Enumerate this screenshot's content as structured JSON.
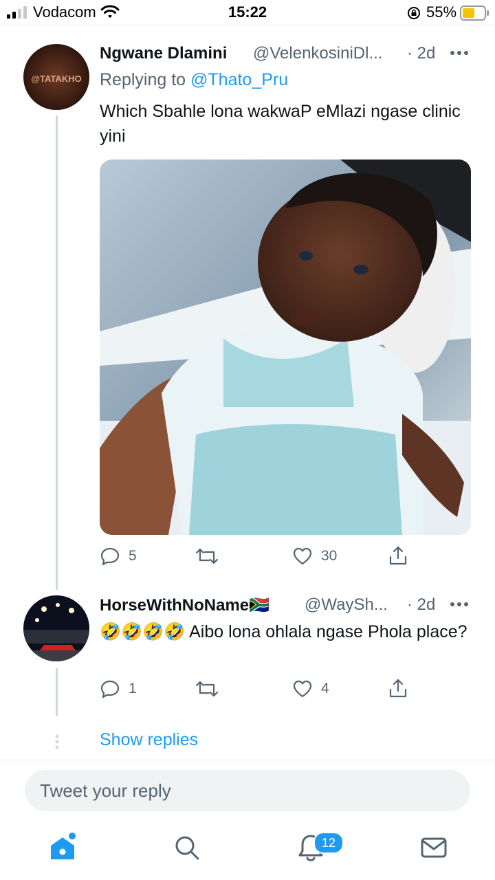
{
  "status_bar": {
    "carrier": "Vodacom",
    "time": "15:22",
    "battery": "55%"
  },
  "tweets": [
    {
      "author_name": "Ngwane Dlamini",
      "handle": "@VelenkosiniDl...",
      "age": "· 2d",
      "replying_prefix": "Replying to",
      "replying_to": "@Thato_Pru",
      "text": "Which Sbahle lona wakwaP eMlazi ngase clinic yini",
      "avatar_text": "@TATAKHO",
      "replies": "5",
      "retweets": "",
      "likes": "30"
    },
    {
      "author_name": "HorseWithNoName",
      "flag": "🇿🇦",
      "handle": "@WaySh...",
      "age": "· 2d",
      "emojis": "🤣🤣🤣🤣",
      "text": "Aibo lona ohlala ngase Phola place?",
      "replies": "1",
      "retweets": "",
      "likes": "4"
    }
  ],
  "show_replies": "Show replies",
  "composer": {
    "placeholder": "Tweet your reply"
  },
  "tabbar": {
    "notifications_badge": "12"
  },
  "colors": {
    "accent": "#1d9bf0",
    "secondary_text": "#536471",
    "battery_fill": "#f5c400"
  }
}
